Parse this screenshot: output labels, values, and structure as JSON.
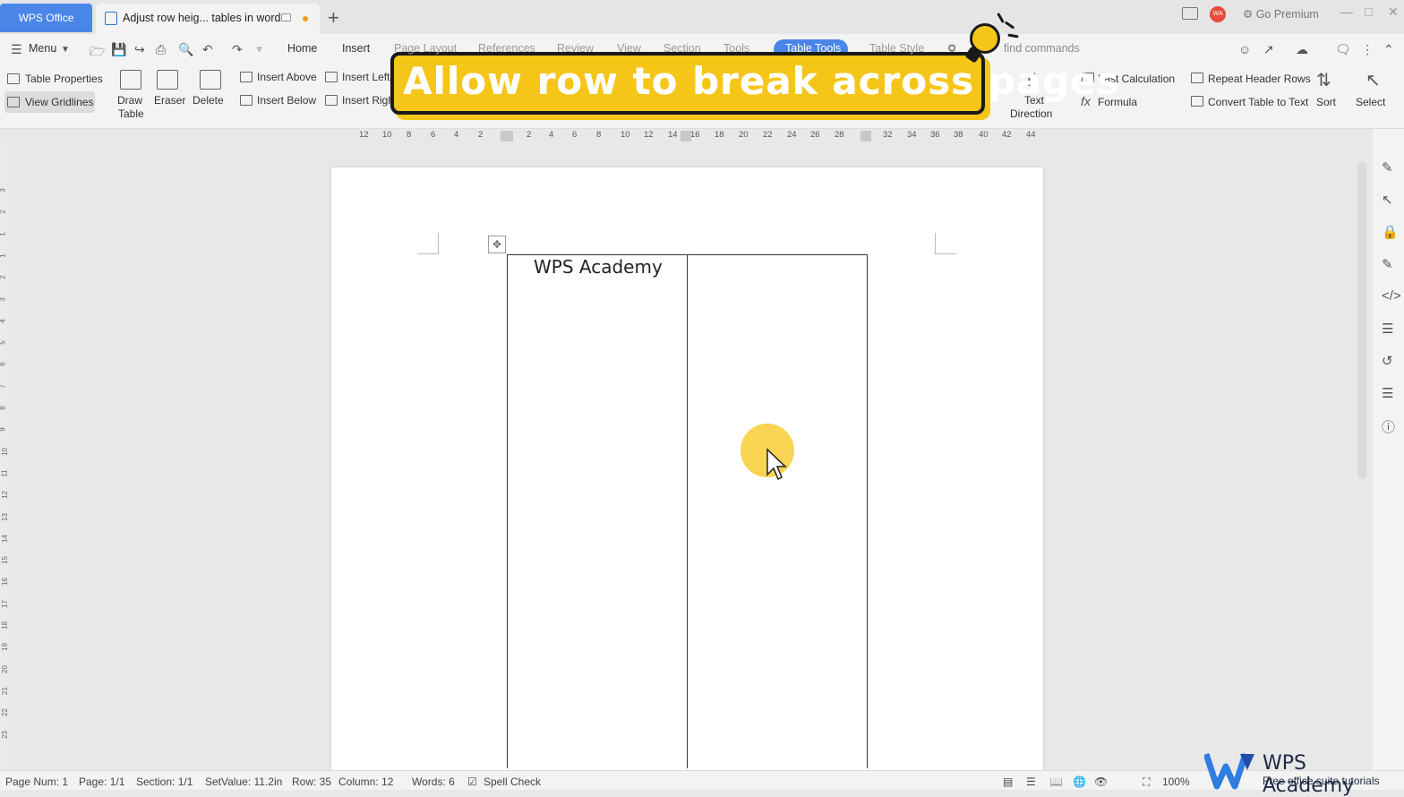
{
  "titlebar": {
    "app_tab": "WPS Office",
    "doc_tab": "Adjust row heig... tables in word",
    "new_tab": "+",
    "avatar": "WA",
    "go_premium": "Go Premium"
  },
  "menubar": {
    "menu": "Menu",
    "tabs": [
      "Home",
      "Insert",
      "Page Layout",
      "References",
      "Review",
      "View",
      "Section",
      "Tools",
      "Table Tools",
      "Table Style"
    ],
    "search_placeholder": "find commands"
  },
  "ribbon": {
    "table_properties": "Table Properties",
    "view_gridlines": "View Gridlines",
    "draw_table": [
      "Draw",
      "Table"
    ],
    "eraser": "Eraser",
    "delete": "Delete",
    "insert_above": "Insert Above",
    "insert_below": "Insert Below",
    "insert_left": "Insert Left",
    "insert_right": "Insert Right",
    "text_direction": [
      "Text",
      "Direction"
    ],
    "fast_calculation": "Fast Calculation",
    "formula": "Formula",
    "repeat_header_rows": "Repeat Header Rows",
    "convert_table_to_text": "Convert Table to Text",
    "sort": "Sort",
    "select": "Select"
  },
  "banner": {
    "text": "Allow row to break across pages",
    "accent": "#f5c518"
  },
  "ruler": {
    "numbers": [
      "12",
      "10",
      "8",
      "6",
      "4",
      "2",
      "2",
      "4",
      "6",
      "8",
      "10",
      "12",
      "14",
      "16",
      "18",
      "20",
      "22",
      "24",
      "26",
      "28",
      "32",
      "34",
      "36",
      "38",
      "40",
      "42",
      "44"
    ]
  },
  "vruler": {
    "numbers": [
      "3",
      "2",
      "1",
      "1",
      "2",
      "3",
      "4",
      "5",
      "6",
      "7",
      "8",
      "9",
      "10",
      "11",
      "12",
      "13",
      "14",
      "15",
      "16",
      "17",
      "18",
      "19",
      "20",
      "21",
      "22",
      "23"
    ]
  },
  "document": {
    "cell_text": "WPS Academy"
  },
  "status": {
    "page_num": "Page Num: 1",
    "page": "Page: 1/1",
    "section": "Section: 1/1",
    "setvalue": "SetValue: 11.2in",
    "row": "Row: 35",
    "column": "Column: 12",
    "words": "Words: 6",
    "spell_check": "Spell Check",
    "zoom": "100%"
  },
  "watermark": {
    "name": "WPS Academy",
    "tagline": "Free office suite tutorials"
  }
}
